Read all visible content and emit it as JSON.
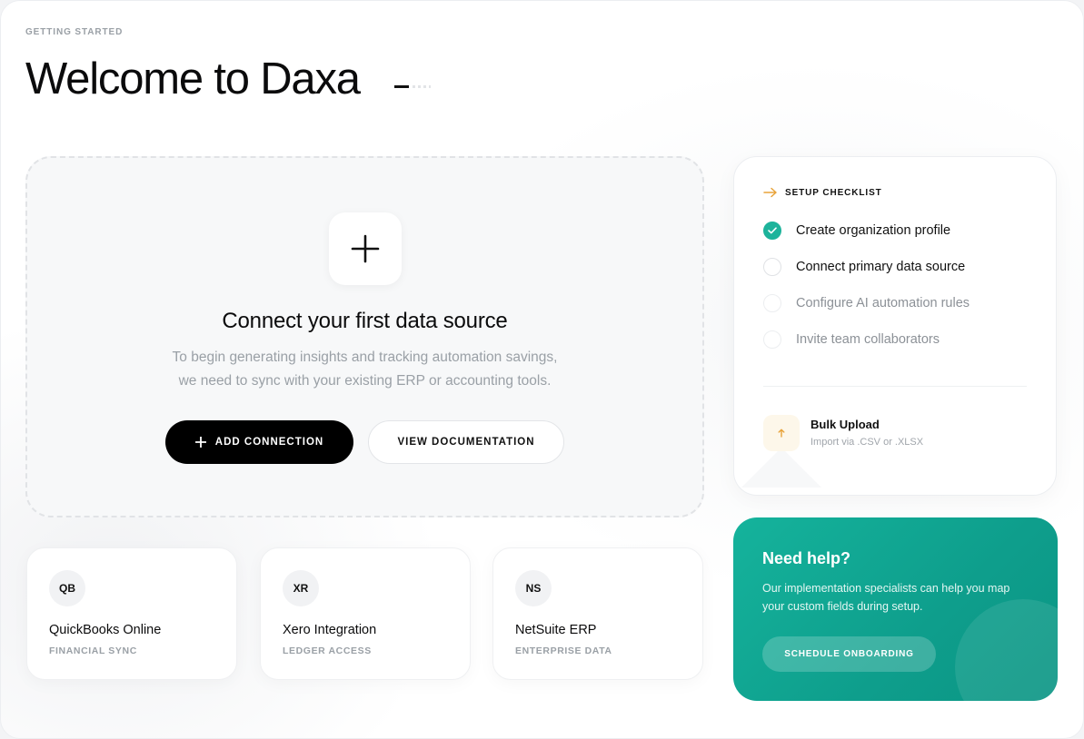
{
  "header": {
    "eyebrow": "GETTING STARTED",
    "title": "Welcome to Daxa"
  },
  "dropzone": {
    "icon": "plus-icon",
    "title": "Connect your first data source",
    "description_lines": [
      "To begin generating insights and tracking automation savings,",
      "we need to sync with your existing ERP or accounting tools."
    ],
    "primary_button": "ADD CONNECTION",
    "secondary_button": "VIEW DOCUMENTATION"
  },
  "integrations": [
    {
      "badge": "QB",
      "name": "QuickBooks Online",
      "subtitle": "FINANCIAL SYNC"
    },
    {
      "badge": "XR",
      "name": "Xero Integration",
      "subtitle": "LEDGER ACCESS"
    },
    {
      "badge": "NS",
      "name": "NetSuite ERP",
      "subtitle": "ENTERPRISE DATA"
    }
  ],
  "checklist": {
    "heading": "SETUP CHECKLIST",
    "items": [
      {
        "label": "Create organization profile",
        "status": "done"
      },
      {
        "label": "Connect primary data source",
        "status": "pending"
      },
      {
        "label": "Configure AI automation rules",
        "status": "upcoming"
      },
      {
        "label": "Invite team collaborators",
        "status": "upcoming"
      }
    ],
    "bulk_upload": {
      "title": "Bulk Upload",
      "subtitle": "Import via .CSV or .XLSX"
    }
  },
  "help": {
    "title": "Need help?",
    "description_lines": [
      "Our implementation specialists can help you map",
      "your custom fields during setup."
    ],
    "button": "SCHEDULE ONBOARDING"
  },
  "colors": {
    "accent_teal": "#1db39b",
    "primary_button": "#000000",
    "upload_arrow": "#e8a33a",
    "checklist_arrow": "#e8a33a"
  }
}
